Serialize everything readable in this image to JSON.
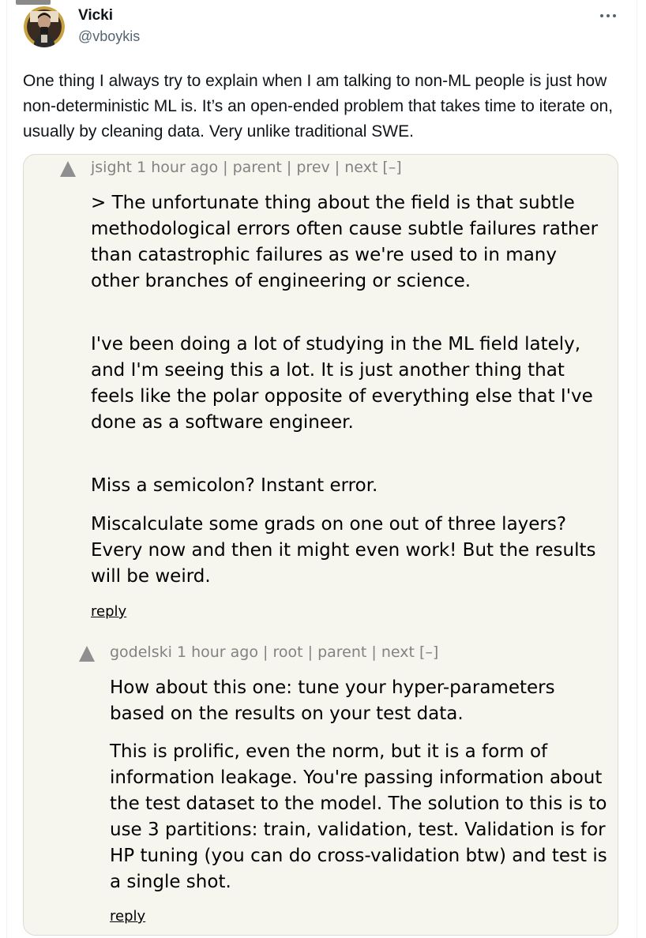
{
  "tweet": {
    "author_name": "Vicki",
    "author_handle": "@vboykis",
    "more_icon": "more-horizontal-icon",
    "text": "One thing I always try to explain when I am talking to non-ML people is just how non-deterministic ML is. It’s an open-ended problem that takes time to iterate on, usually by cleaning data. Very unlike traditional SWE."
  },
  "embed": {
    "comments": [
      {
        "user": "jsight",
        "age": "1 hour ago",
        "sep": "|",
        "links": [
          "parent",
          "prev",
          "next"
        ],
        "toggle": "[–]",
        "paragraphs": [
          "> The unfortunate thing about the field is that subtle methodological errors often cause subtle failures rather than catastrophic failures as we're used to in many other branches of engineering or science.",
          "I've been doing a lot of studying in the ML field lately, and I'm seeing this a lot. It is just another thing that feels like the polar opposite of everything else that I've done as a software engineer.",
          "Miss a semicolon? Instant error.",
          "Miscalculate some grads on one out of three layers? Every now and then it might even work! But the results will be weird."
        ],
        "reply": "reply"
      },
      {
        "user": "godelski",
        "age": "1 hour ago",
        "sep": "|",
        "links": [
          "root",
          "parent",
          "next"
        ],
        "toggle": "[–]",
        "paragraphs": [
          "How about this one: tune your hyper-parameters based on the results on your test data.",
          "This is prolific, even the norm, but it is a form of information leakage. You're passing information about the test dataset to the model. The solution to this is to use 3 partitions: train, validation, test. Validation is for HP tuning (you can do cross-validation btw) and test is a single shot."
        ],
        "reply": "reply"
      }
    ]
  }
}
